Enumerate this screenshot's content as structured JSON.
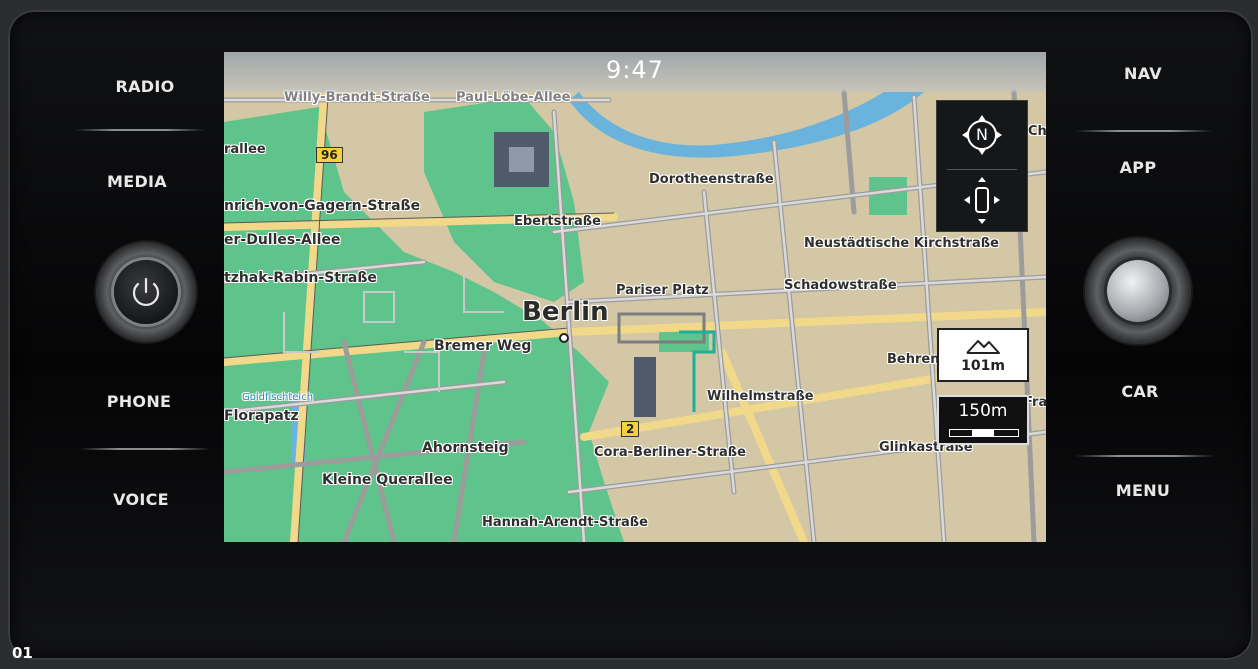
{
  "left_buttons": [
    {
      "label": "RADIO"
    },
    {
      "label": "MEDIA"
    },
    {
      "label": "PHONE"
    },
    {
      "label": "VOICE"
    }
  ],
  "right_buttons": [
    {
      "label": "NAV"
    },
    {
      "label": "APP"
    },
    {
      "label": "CAR"
    },
    {
      "label": "MENU"
    }
  ],
  "status": {
    "time": "9:47"
  },
  "map": {
    "city": "Berlin",
    "streets": [
      "Willy-Brandt-Straße",
      "Paul-Löbe-Allee",
      "rallee",
      "nrich-von-Gagern-Straße",
      "er-Dulles-Allee",
      "tzhak-Rabin-Straße",
      "Dorotheenstraße",
      "Ebertstraße",
      "Neustädtische Kirchstraße",
      "Schadowstraße",
      "Pariser Platz",
      "Bremer Weg",
      "Behrenstr",
      "Wilhelmstraße",
      "Cora-Berliner-Straße",
      "Glinkastraße",
      "Ahornsteig",
      "Kleine Querallee",
      "Florapatz",
      "Goldfischteich",
      "Hannah-Arendt-Straße",
      "Ch",
      "Fran"
    ],
    "road_numbers": [
      "96",
      "2"
    ]
  },
  "controls": {
    "compass_letter": "N",
    "elevation": "101m",
    "scale": "150m"
  },
  "footer": {
    "figure_number": "01"
  },
  "colors": {
    "park": "#5ec48b",
    "land": "#d3c7a6",
    "water": "#6ab3dd",
    "road_major": "#f2d98a",
    "road_minor": "#9a9a9a"
  }
}
